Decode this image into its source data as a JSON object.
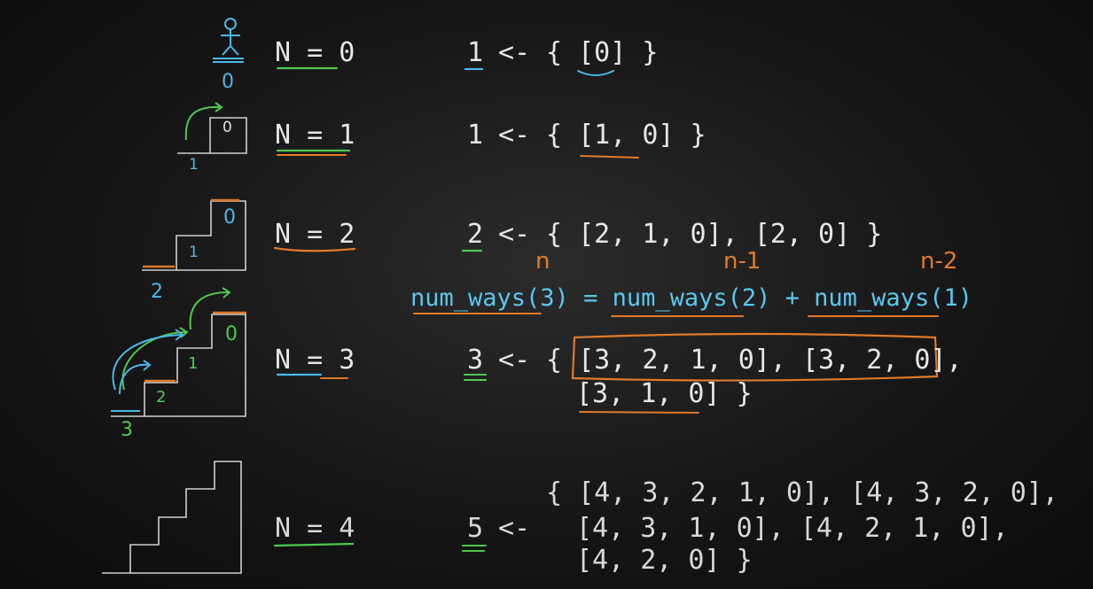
{
  "rows": [
    {
      "n_label": "N = 0",
      "count": "1",
      "arrow": "<-",
      "sets": [
        "{ [0] }"
      ]
    },
    {
      "n_label": "N = 1",
      "count": "1",
      "arrow": "<-",
      "sets": [
        "{ [1, 0] }"
      ]
    },
    {
      "n_label": "N = 2",
      "count": "2",
      "arrow": "<-",
      "sets": [
        "{ [2, 1, 0], [2, 0] }"
      ]
    },
    {
      "n_label": "N = 3",
      "count": "3",
      "arrow": "<-",
      "sets": [
        "{ [3, 2, 1, 0], [3, 2, 0],",
        "[3, 1, 0] }"
      ]
    },
    {
      "n_label": "N = 4",
      "count": "5",
      "arrow": "<-",
      "sets": [
        "{ [4, 3, 2, 1, 0], [4, 3, 2, 0],",
        "[4, 3, 1, 0], [4, 2, 1, 0],",
        "[4, 2, 0] }"
      ]
    }
  ],
  "recurrence": "num_ways(3) = num_ways(2) + num_ways(1)",
  "annotations": {
    "n": "n",
    "n_minus_1": "n-1",
    "n_minus_2": "n-2"
  },
  "stair_labels": {
    "s0": [
      "0"
    ],
    "s1": [
      "0",
      "1"
    ],
    "s2": [
      "0",
      "1",
      "2"
    ],
    "s3": [
      "0",
      "1",
      "2",
      "3"
    ]
  },
  "colors": {
    "background": "#161616",
    "text": "#e6e6e6",
    "green": "#4fc94f",
    "orange": "#e07a2a",
    "blue": "#4ab8e8",
    "stairs": "#d0d0d0"
  }
}
